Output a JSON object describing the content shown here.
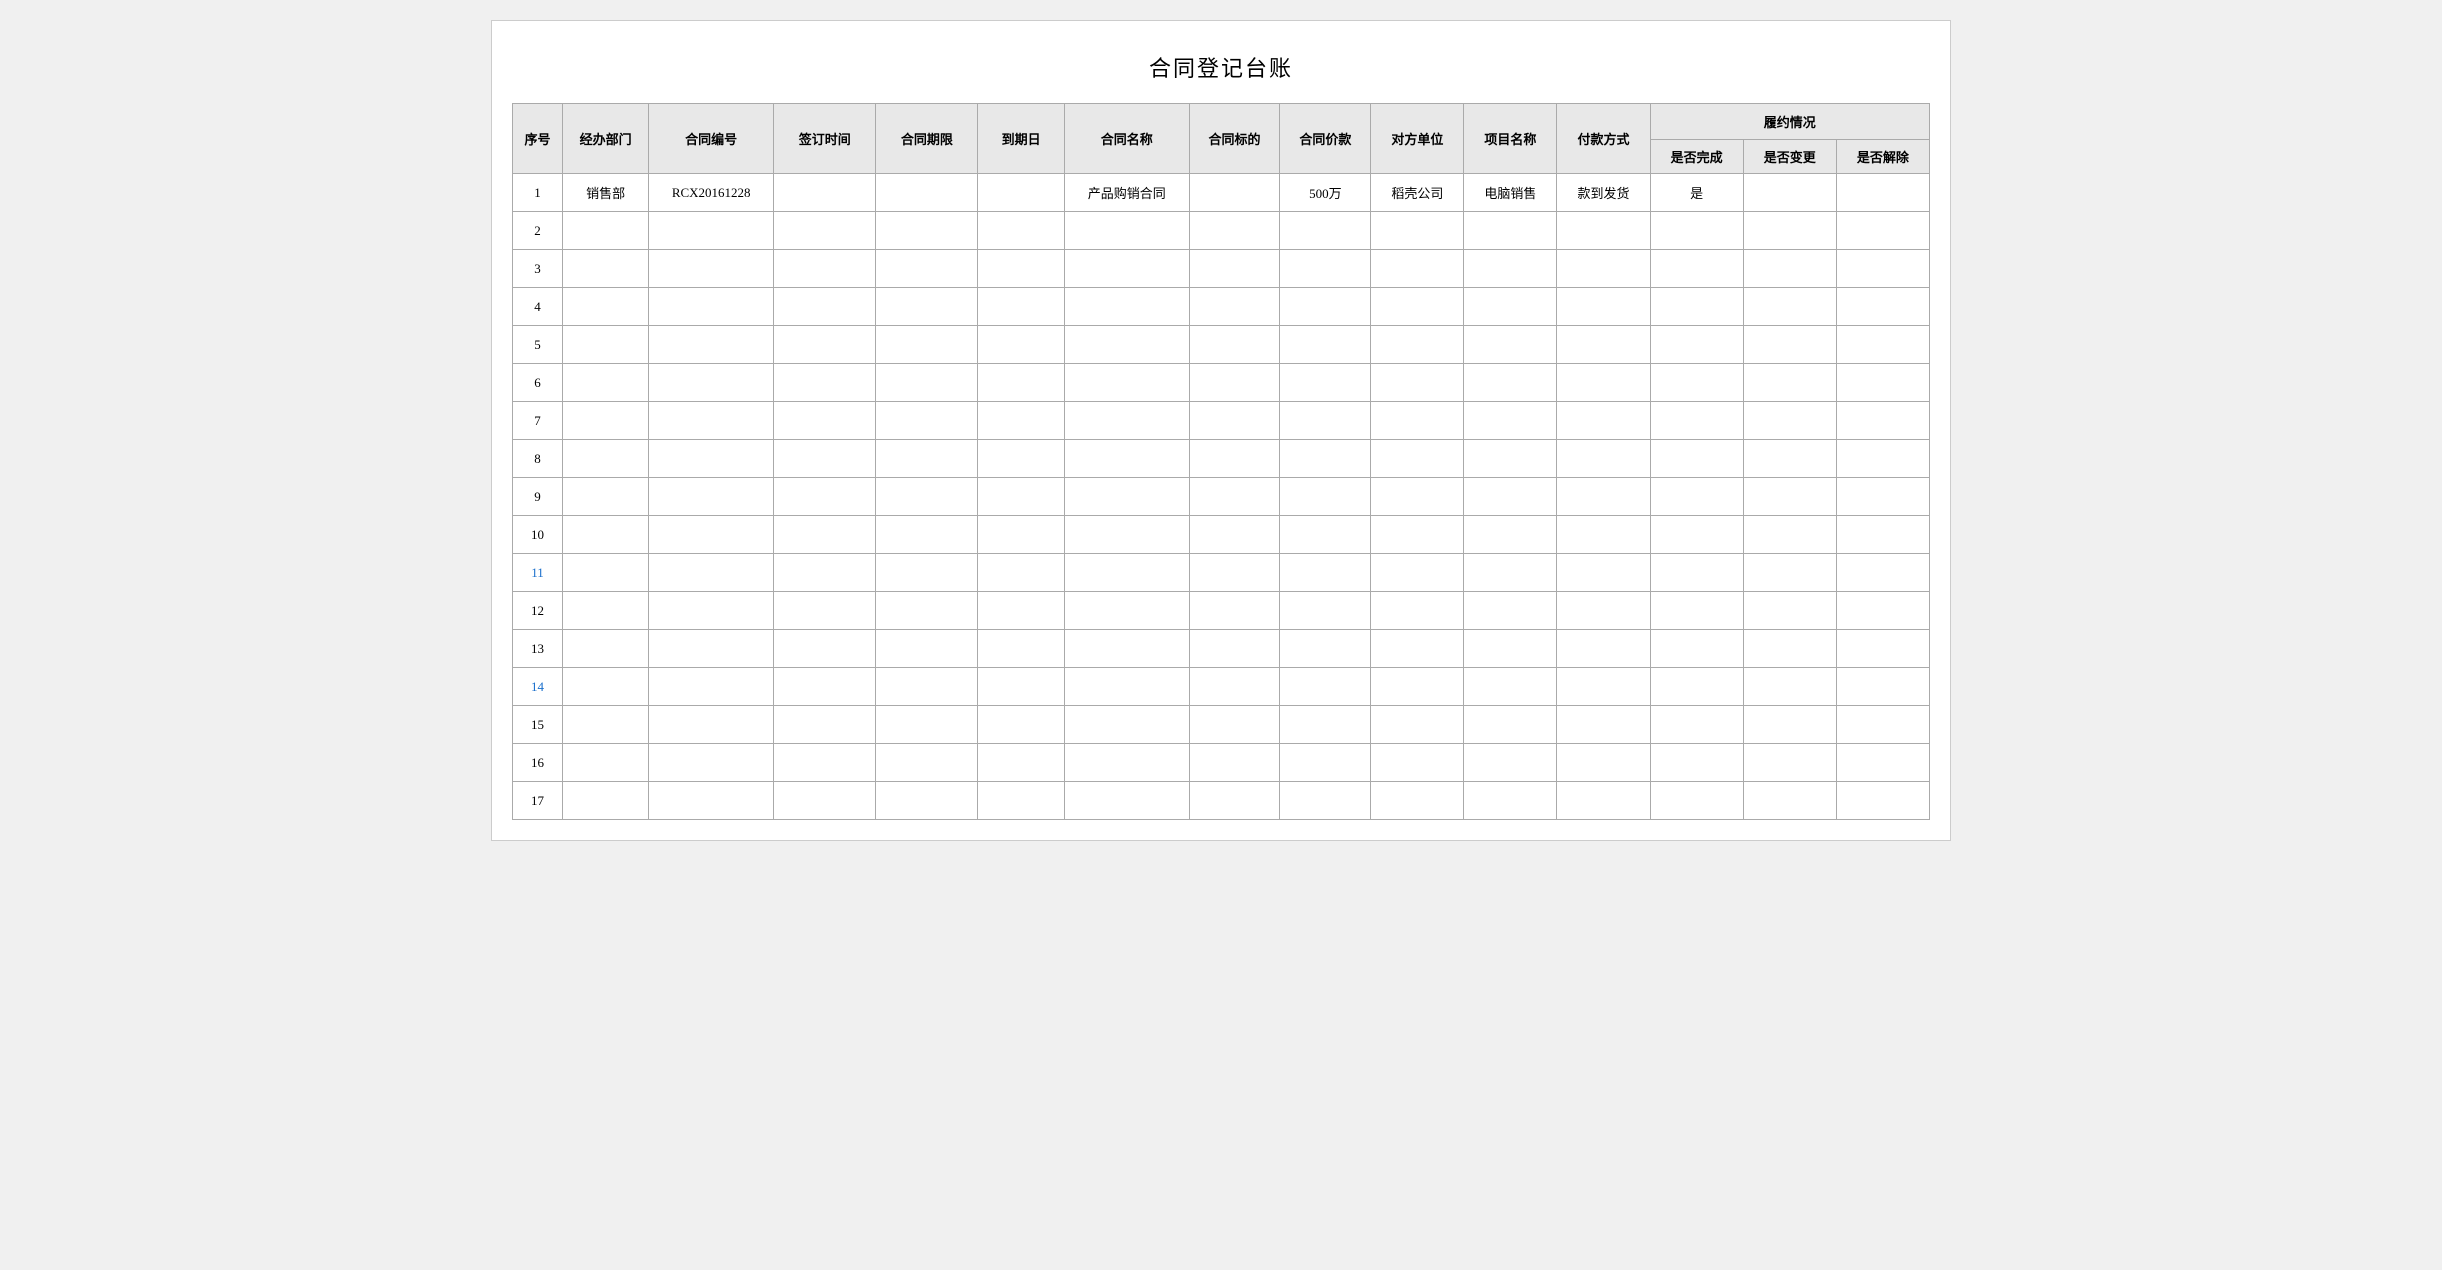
{
  "title": "合同登记台账",
  "table": {
    "header": {
      "row1": {
        "seq": "序号",
        "dept": "经办部门",
        "contract_no": "合同编号",
        "sign_time": "签订时间",
        "period": "合同期限",
        "due_date": "到期日",
        "name": "合同名称",
        "target": "合同标的",
        "price": "合同价款",
        "party": "对方单位",
        "project": "项目名称",
        "payment": "付款方式",
        "compliance_group": "履约情况"
      },
      "row2": {
        "done": "是否完成",
        "change": "是否变更",
        "cancel": "是否解除"
      }
    },
    "rows": [
      {
        "seq": "1",
        "dept": "销售部",
        "contract_no": "RCX20161228",
        "sign_time": "",
        "period": "",
        "due_date": "",
        "name": "产品购销合同",
        "target": "",
        "price": "500万",
        "party": "稻壳公司",
        "project": "电脑销售",
        "payment": "款到发货",
        "done": "是",
        "change": "",
        "cancel": ""
      },
      {
        "seq": "2",
        "dept": "",
        "contract_no": "",
        "sign_time": "",
        "period": "",
        "due_date": "",
        "name": "",
        "target": "",
        "price": "",
        "party": "",
        "project": "",
        "payment": "",
        "done": "",
        "change": "",
        "cancel": ""
      },
      {
        "seq": "3",
        "dept": "",
        "contract_no": "",
        "sign_time": "",
        "period": "",
        "due_date": "",
        "name": "",
        "target": "",
        "price": "",
        "party": "",
        "project": "",
        "payment": "",
        "done": "",
        "change": "",
        "cancel": ""
      },
      {
        "seq": "4",
        "dept": "",
        "contract_no": "",
        "sign_time": "",
        "period": "",
        "due_date": "",
        "name": "",
        "target": "",
        "price": "",
        "party": "",
        "project": "",
        "payment": "",
        "done": "",
        "change": "",
        "cancel": ""
      },
      {
        "seq": "5",
        "dept": "",
        "contract_no": "",
        "sign_time": "",
        "period": "",
        "due_date": "",
        "name": "",
        "target": "",
        "price": "",
        "party": "",
        "project": "",
        "payment": "",
        "done": "",
        "change": "",
        "cancel": ""
      },
      {
        "seq": "6",
        "dept": "",
        "contract_no": "",
        "sign_time": "",
        "period": "",
        "due_date": "",
        "name": "",
        "target": "",
        "price": "",
        "party": "",
        "project": "",
        "payment": "",
        "done": "",
        "change": "",
        "cancel": ""
      },
      {
        "seq": "7",
        "dept": "",
        "contract_no": "",
        "sign_time": "",
        "period": "",
        "due_date": "",
        "name": "",
        "target": "",
        "price": "",
        "party": "",
        "project": "",
        "payment": "",
        "done": "",
        "change": "",
        "cancel": ""
      },
      {
        "seq": "8",
        "dept": "",
        "contract_no": "",
        "sign_time": "",
        "period": "",
        "due_date": "",
        "name": "",
        "target": "",
        "price": "",
        "party": "",
        "project": "",
        "payment": "",
        "done": "",
        "change": "",
        "cancel": ""
      },
      {
        "seq": "9",
        "dept": "",
        "contract_no": "",
        "sign_time": "",
        "period": "",
        "due_date": "",
        "name": "",
        "target": "",
        "price": "",
        "party": "",
        "project": "",
        "payment": "",
        "done": "",
        "change": "",
        "cancel": ""
      },
      {
        "seq": "10",
        "dept": "",
        "contract_no": "",
        "sign_time": "",
        "period": "",
        "due_date": "",
        "name": "",
        "target": "",
        "price": "",
        "party": "",
        "project": "",
        "payment": "",
        "done": "",
        "change": "",
        "cancel": ""
      },
      {
        "seq": "11",
        "dept": "",
        "contract_no": "",
        "sign_time": "",
        "period": "",
        "due_date": "",
        "name": "",
        "target": "",
        "price": "",
        "party": "",
        "project": "",
        "payment": "",
        "done": "",
        "change": "",
        "cancel": "",
        "highlight": "blue"
      },
      {
        "seq": "12",
        "dept": "",
        "contract_no": "",
        "sign_time": "",
        "period": "",
        "due_date": "",
        "name": "",
        "target": "",
        "price": "",
        "party": "",
        "project": "",
        "payment": "",
        "done": "",
        "change": "",
        "cancel": ""
      },
      {
        "seq": "13",
        "dept": "",
        "contract_no": "",
        "sign_time": "",
        "period": "",
        "due_date": "",
        "name": "",
        "target": "",
        "price": "",
        "party": "",
        "project": "",
        "payment": "",
        "done": "",
        "change": "",
        "cancel": ""
      },
      {
        "seq": "14",
        "dept": "",
        "contract_no": "",
        "sign_time": "",
        "period": "",
        "due_date": "",
        "name": "",
        "target": "",
        "price": "",
        "party": "",
        "project": "",
        "payment": "",
        "done": "",
        "change": "",
        "cancel": "",
        "highlight": "blue"
      },
      {
        "seq": "15",
        "dept": "",
        "contract_no": "",
        "sign_time": "",
        "period": "",
        "due_date": "",
        "name": "",
        "target": "",
        "price": "",
        "party": "",
        "project": "",
        "payment": "",
        "done": "",
        "change": "",
        "cancel": ""
      },
      {
        "seq": "16",
        "dept": "",
        "contract_no": "",
        "sign_time": "",
        "period": "",
        "due_date": "",
        "name": "",
        "target": "",
        "price": "",
        "party": "",
        "project": "",
        "payment": "",
        "done": "",
        "change": "",
        "cancel": ""
      },
      {
        "seq": "17",
        "dept": "",
        "contract_no": "",
        "sign_time": "",
        "period": "",
        "due_date": "",
        "name": "",
        "target": "",
        "price": "",
        "party": "",
        "project": "",
        "payment": "",
        "done": "",
        "change": "",
        "cancel": ""
      }
    ]
  }
}
